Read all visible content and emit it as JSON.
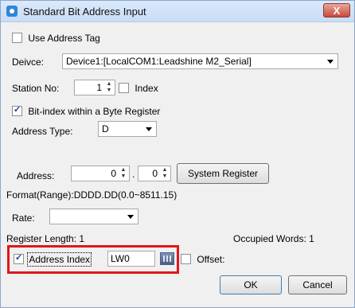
{
  "window": {
    "title": "Standard Bit Address Input",
    "close_label": "X"
  },
  "use_address_tag": {
    "label": "Use Address Tag",
    "checked": false
  },
  "device": {
    "label": "Deivce:",
    "value": "Device1:[LocalCOM1:Leadshine M2_Serial]"
  },
  "station": {
    "label": "Station No:",
    "value": "1",
    "index_label": "Index",
    "index_checked": false
  },
  "bit_index": {
    "label": "Bit-index within a Byte Register",
    "checked": true
  },
  "address_type": {
    "label": "Address Type:",
    "value": "D"
  },
  "address": {
    "label": "Address:",
    "word_value": "0",
    "separator": ".",
    "bit_value": "0",
    "system_register_label": "System Register"
  },
  "format_text": "Format(Range):DDDD.DD(0.0~8511.15)",
  "rate": {
    "label": "Rate:",
    "value": ""
  },
  "register_length": "Register Length: 1",
  "occupied_words": "Occupied Words: 1",
  "address_index": {
    "label": "Address Index",
    "checked": true,
    "value": "LW0"
  },
  "offset": {
    "label": "Offset:",
    "checked": false
  },
  "buttons": {
    "ok": "OK",
    "cancel": "Cancel"
  },
  "colors": {
    "highlight": "#e0161b",
    "title_bar": "#c8dcf5"
  }
}
